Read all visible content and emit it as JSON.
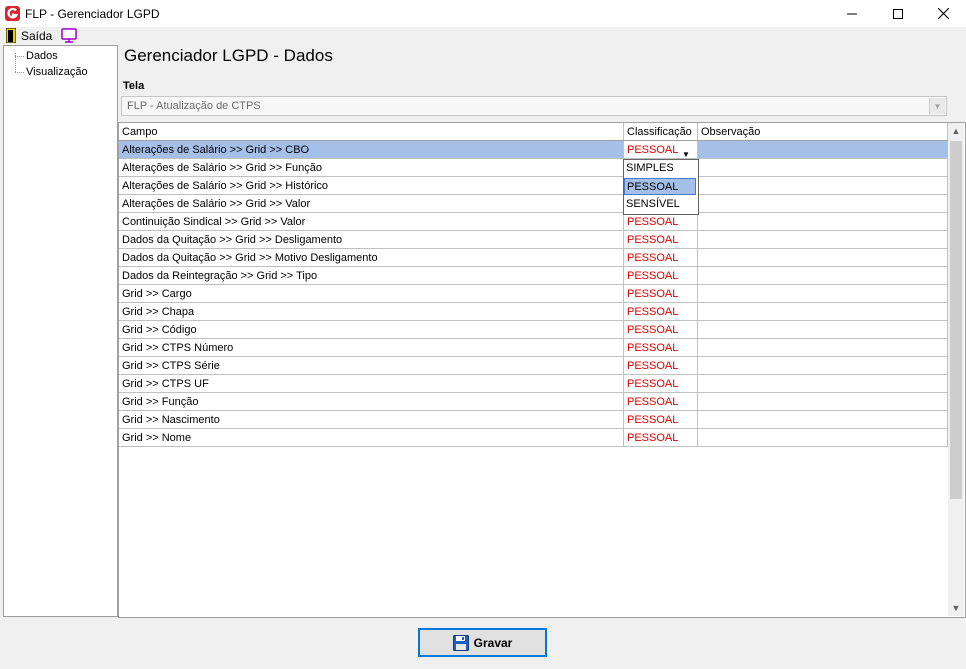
{
  "window": {
    "title": "FLP - Gerenciador LGPD",
    "minimize_glyph": "—",
    "maximize_glyph": "☐",
    "close_glyph": "✕"
  },
  "menu": {
    "exit_label": "Saída"
  },
  "tree": {
    "items": [
      {
        "label": "Dados"
      },
      {
        "label": "Visualização"
      }
    ]
  },
  "main": {
    "title": "Gerenciador LGPD - Dados",
    "tela_label": "Tela",
    "tela_value": "FLP - Atualização de CTPS"
  },
  "grid": {
    "columns": [
      "Campo",
      "Classificação",
      "Observação"
    ],
    "rows": [
      {
        "campo": "Alterações de Salário >> Grid >> CBO",
        "classificacao": "PESSOAL",
        "observacao": ""
      },
      {
        "campo": "Alterações de Salário >> Grid >> Função",
        "classificacao": "",
        "observacao": ""
      },
      {
        "campo": "Alterações de Salário >> Grid >> Histórico",
        "classificacao": "",
        "observacao": ""
      },
      {
        "campo": "Alterações de Salário >> Grid >> Valor",
        "classificacao": "",
        "observacao": ""
      },
      {
        "campo": "Continuição Sindical >> Grid >> Valor",
        "classificacao": "PESSOAL",
        "observacao": ""
      },
      {
        "campo": "Dados da Quitação >> Grid >> Desligamento",
        "classificacao": "PESSOAL",
        "observacao": ""
      },
      {
        "campo": "Dados da Quitação >> Grid >> Motivo Desligamento",
        "classificacao": "PESSOAL",
        "observacao": ""
      },
      {
        "campo": "Dados da Reintegração >> Grid >> Tipo",
        "classificacao": "PESSOAL",
        "observacao": ""
      },
      {
        "campo": "Grid >> Cargo",
        "classificacao": "PESSOAL",
        "observacao": ""
      },
      {
        "campo": "Grid >> Chapa",
        "classificacao": "PESSOAL",
        "observacao": ""
      },
      {
        "campo": "Grid >> Código",
        "classificacao": "PESSOAL",
        "observacao": ""
      },
      {
        "campo": "Grid >> CTPS Número",
        "classificacao": "PESSOAL",
        "observacao": ""
      },
      {
        "campo": "Grid >> CTPS Série",
        "classificacao": "PESSOAL",
        "observacao": ""
      },
      {
        "campo": "Grid >> CTPS UF",
        "classificacao": "PESSOAL",
        "observacao": ""
      },
      {
        "campo": "Grid >> Função",
        "classificacao": "PESSOAL",
        "observacao": ""
      },
      {
        "campo": "Grid >> Nascimento",
        "classificacao": "PESSOAL",
        "observacao": ""
      },
      {
        "campo": "Grid >> Nome",
        "classificacao": "PESSOAL",
        "observacao": ""
      }
    ],
    "dropdown_options": [
      "SIMPLES",
      "PESSOAL",
      "SENSÍVEL"
    ],
    "dropdown_selected": "PESSOAL"
  },
  "buttons": {
    "save_label": "Gravar"
  },
  "colors": {
    "selection": "#a4bfe8",
    "classification_text": "#e00000",
    "accent": "#0078d7"
  }
}
